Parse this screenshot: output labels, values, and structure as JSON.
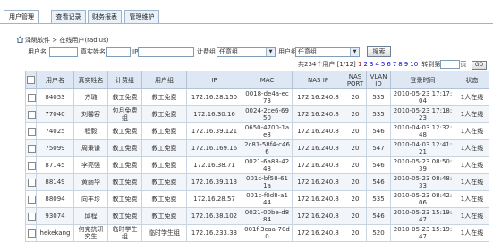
{
  "tabs": [
    "用户管理",
    "查看记录",
    "财务报表",
    "管理维护"
  ],
  "breadcrumb": {
    "root": "泽眺软件",
    "sep": ">",
    "current": "在线用户(radius)"
  },
  "filters": {
    "username_label": "用户名",
    "realname_label": "真实姓名",
    "ip_label": "IP",
    "billing_group_label": "计费组",
    "billing_group_value": "任意组",
    "user_group_label": "用户组",
    "user_group_value": "任意组",
    "search_button": "搜索"
  },
  "pager": {
    "summary": "共234个用户 [1/12]",
    "pages": [
      "1",
      "2",
      "3",
      "4",
      "5",
      "6",
      "7",
      "8",
      "9",
      "10"
    ],
    "current": "1",
    "goto_prefix": "转到第",
    "goto_suffix": "页",
    "go_button": "GO"
  },
  "table": {
    "headers": [
      "",
      "用户名",
      "真实姓名",
      "计费组",
      "用户组",
      "IP",
      "MAC",
      "NAS IP",
      "NAS PORT",
      "VLAN ID",
      "登录时间",
      "状态"
    ],
    "rows": [
      {
        "username": "84053",
        "realname": "方璐",
        "billing": "教工免费",
        "group": "教工免费",
        "ip": "172.16.28.150",
        "mac": "0018-de4a-ec73",
        "nasip": "172.16.240.8",
        "port": "20",
        "vlan": "535",
        "time": "2010-05-23 17:17:04",
        "status": "1人在线"
      },
      {
        "username": "77040",
        "realname": "刘馨容",
        "billing": "包月免费组",
        "group": "教工免费",
        "ip": "172.16.30.16",
        "mac": "0024-2ce6-6950",
        "nasip": "172.16.240.8",
        "port": "20",
        "vlan": "535",
        "time": "2010-05-23 17:18:23",
        "status": "1人在线"
      },
      {
        "username": "74025",
        "realname": "程毅",
        "billing": "教工免费",
        "group": "教工免费",
        "ip": "172.16.39.121",
        "mac": "0650-4700-1ae8",
        "nasip": "172.16.240.8",
        "port": "20",
        "vlan": "546",
        "time": "2010-04-03 12:32:48",
        "status": "1人在线"
      },
      {
        "username": "75099",
        "realname": "周秉谦",
        "billing": "教工免费",
        "group": "教工免费",
        "ip": "172.16.169.16",
        "mac": "2c81-58f4-c466",
        "nasip": "172.16.240.8",
        "port": "20",
        "vlan": "547",
        "time": "2010-04-03 12:41:21",
        "status": "1人在线"
      },
      {
        "username": "87145",
        "realname": "李亮强",
        "billing": "教工免费",
        "group": "教工免费",
        "ip": "172.16.38.71",
        "mac": "0021-6a83-4248",
        "nasip": "172.16.240.8",
        "port": "20",
        "vlan": "546",
        "time": "2010-05-23 08:50:39",
        "status": "1人在线"
      },
      {
        "username": "88149",
        "realname": "黄丽华",
        "billing": "教工免费",
        "group": "教工免费",
        "ip": "172.16.39.113",
        "mac": "001c-bf58-611a",
        "nasip": "172.16.240.8",
        "port": "20",
        "vlan": "546",
        "time": "2010-05-23 08:48:33",
        "status": "1人在线"
      },
      {
        "username": "88094",
        "realname": "向丰珍",
        "billing": "教工免费",
        "group": "教工免费",
        "ip": "172.16.28.57",
        "mac": "001c-f0d8-a144",
        "nasip": "172.16.240.8",
        "port": "20",
        "vlan": "535",
        "time": "2010-05-23 08:42:06",
        "status": "1人在线"
      },
      {
        "username": "93074",
        "realname": "邱程",
        "billing": "教工免费",
        "group": "教工免费",
        "ip": "172.16.38.102",
        "mac": "0021-00be-d884",
        "nasip": "172.16.240.8",
        "port": "20",
        "vlan": "546",
        "time": "2010-05-23 15:19:47",
        "status": "1人在线"
      },
      {
        "username": "hekekang",
        "realname": "何克抗研究生",
        "billing": "临时学生组",
        "group": "临时学生组",
        "ip": "172.16.233.33",
        "mac": "001f-3caa-70d0",
        "nasip": "172.16.240.8",
        "port": "20",
        "vlan": "520",
        "time": "2010-05-23 15:19:47",
        "status": "1人在线"
      }
    ]
  }
}
